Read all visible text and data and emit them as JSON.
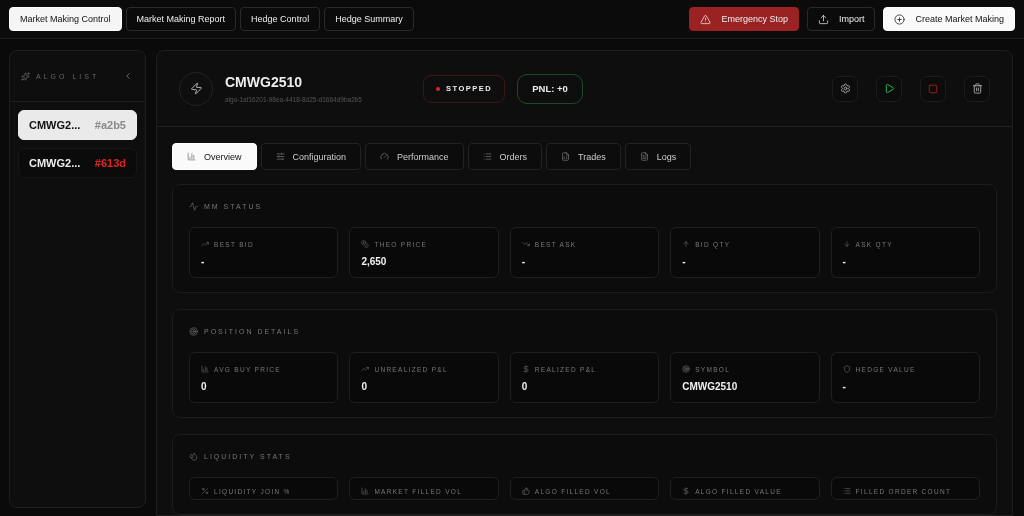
{
  "nav_tabs": [
    {
      "label": "Market Making Control",
      "selected": true
    },
    {
      "label": "Market Making Report",
      "selected": false
    },
    {
      "label": "Hedge Control",
      "selected": false
    },
    {
      "label": "Hedge Summary",
      "selected": false
    }
  ],
  "actions": [
    {
      "kind": "danger",
      "label": "Emergency Stop"
    },
    {
      "kind": "import",
      "label": "Import"
    },
    {
      "kind": "create",
      "label": "Create Market Making"
    }
  ],
  "sidebar": {
    "title": "ALGO LIST",
    "items": [
      {
        "name": "CMWG2...",
        "hash": "#a2b5",
        "color": "#8a8a8a",
        "selected": true
      },
      {
        "name": "CMWG2...",
        "hash": "#613d",
        "color": "#e02424",
        "selected": false
      }
    ]
  },
  "algo": {
    "title": "CMWG2510",
    "id": "algo-1af16201-98ea-4418-8d25-d1664d9ba2b5",
    "status": {
      "kind": "stopped",
      "label": "STOPPED"
    },
    "pnl": "PNL: +0"
  },
  "tabs": [
    {
      "kind": "chart",
      "label": "Overview",
      "selected": true
    },
    {
      "kind": "sliders",
      "label": "Configuration",
      "selected": false
    },
    {
      "kind": "gauge",
      "label": "Performance",
      "selected": false
    },
    {
      "kind": "list",
      "label": "Orders",
      "selected": false
    },
    {
      "kind": "sheet",
      "label": "Trades",
      "selected": false
    },
    {
      "kind": "file",
      "label": "Logs",
      "selected": false
    }
  ],
  "sections": [
    {
      "kind": "activity",
      "title": "MM STATUS",
      "stats": [
        {
          "kind": "trend-up",
          "label": "BEST BID",
          "value": "-"
        },
        {
          "kind": "coin",
          "label": "THEO PRICE",
          "value": "2,650"
        },
        {
          "kind": "trend-down",
          "label": "BEST ASK",
          "value": "-"
        },
        {
          "kind": "arrow-up",
          "label": "BID QTY",
          "value": "-"
        },
        {
          "kind": "arrow-down",
          "label": "ASK QTY",
          "value": "-"
        }
      ]
    },
    {
      "kind": "target",
      "title": "POSITION DETAILS",
      "stats": [
        {
          "kind": "chart",
          "label": "AVG BUY PRICE",
          "value": "0"
        },
        {
          "kind": "trend-up",
          "label": "UNREALIZED P&L",
          "value": "0"
        },
        {
          "kind": "dollar",
          "label": "REALIZED P&L",
          "value": "0"
        },
        {
          "kind": "target",
          "label": "SYMBOL",
          "value": "CMWG2510"
        },
        {
          "kind": "shield",
          "label": "HEDGE VALUE",
          "value": "-"
        }
      ]
    },
    {
      "kind": "droplets",
      "title": "LIQUIDITY STATS",
      "stats": [
        {
          "kind": "percent",
          "label": "LIQUIDITY JOIN %"
        },
        {
          "kind": "chart",
          "label": "MARKET FILLED VOL"
        },
        {
          "kind": "thumbs-up",
          "label": "ALGO FILLED VOL"
        },
        {
          "kind": "dollar",
          "label": "ALGO FILLED VALUE"
        },
        {
          "kind": "list",
          "label": "FILLED ORDER COUNT"
        }
      ]
    }
  ]
}
